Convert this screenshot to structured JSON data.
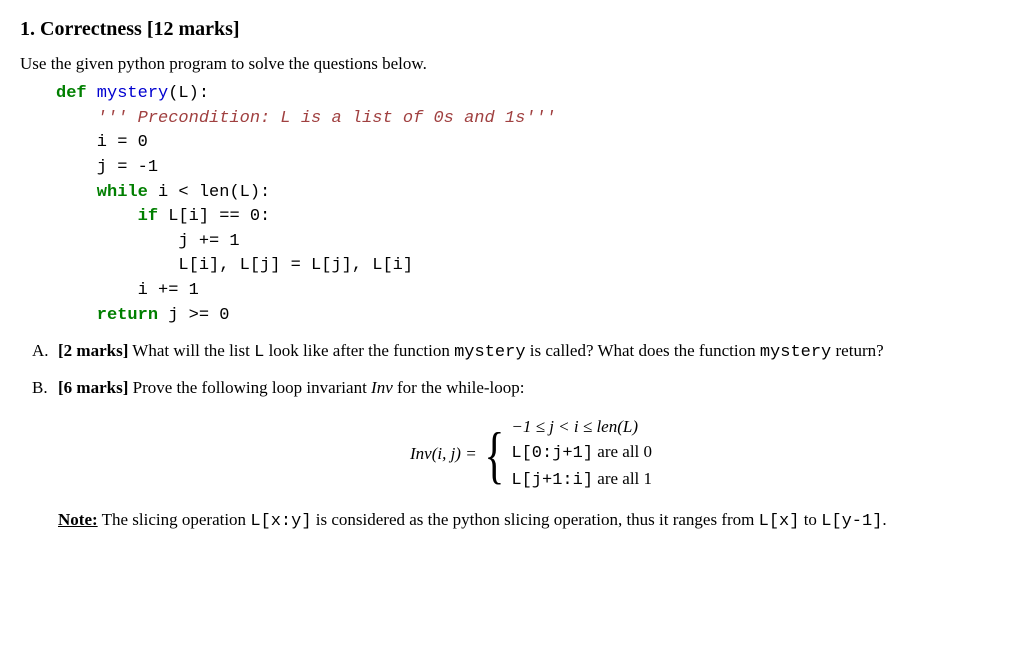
{
  "title": "1. Correctness [12 marks]",
  "intro": "Use the given python program to solve the questions below.",
  "code": {
    "l1_def": "def",
    "l1_fn": " mystery",
    "l1_rest": "(L):",
    "l2_str": "    ''' Precondition: L is a list of 0s and 1s'''",
    "l3": "    i = 0",
    "l4": "    j = -1",
    "l5_kw": "    while",
    "l5_rest": " i < len(L):",
    "l6_kw": "        if",
    "l6_rest": " L[i] == 0:",
    "l7": "            j += 1",
    "l8": "            L[i], L[j] = L[j], L[i]",
    "l9": "        i += 1",
    "l10_kw": "    return",
    "l10_rest": " j >= 0"
  },
  "qA": {
    "letter": "A.",
    "marks": "[2 marks]",
    "p1": " What will the list ",
    "tt1": "L",
    "p2": " look like after the function ",
    "tt2": "mystery",
    "p3": " is called? What does the function ",
    "tt3": "mystery",
    "p4": " return?"
  },
  "qB": {
    "letter": "B.",
    "marks": "[6 marks]",
    "p1": " Prove the following loop invariant ",
    "inv_it": "Inv",
    "p2": " for the while-loop:"
  },
  "math": {
    "lhs_inv": "Inv",
    "lhs_args": "(i, j) = ",
    "case1": "−1 ≤ j < i ≤ len(L)",
    "case2_tt": "L[0:j+1]",
    "case2_txt": " are all 0",
    "case3_tt": "L[j+1:i]",
    "case3_txt": " are all 1"
  },
  "note": {
    "label": "Note:",
    "p1": " The slicing operation ",
    "tt1": "L[x:y]",
    "p2": " is considered as the python slicing operation, thus it ranges from ",
    "tt2": "L[x]",
    "p3": " to ",
    "tt3": "L[y-1]",
    "p4": "."
  }
}
